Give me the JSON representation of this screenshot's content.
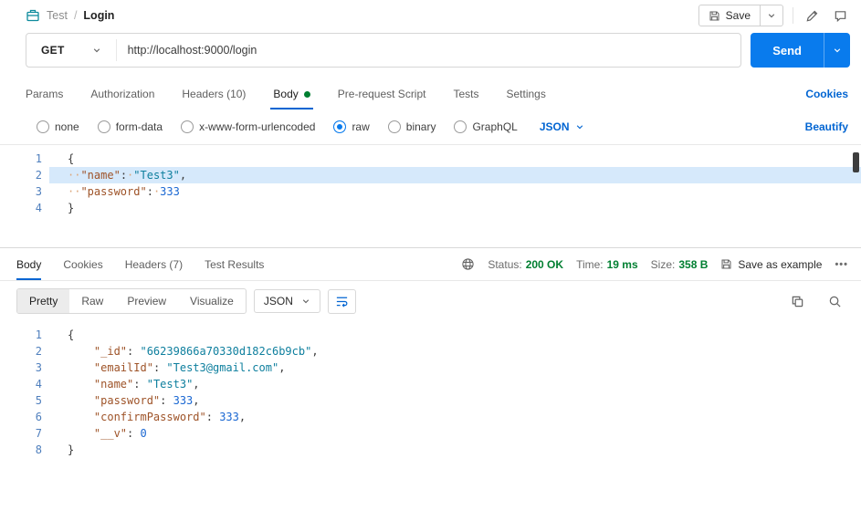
{
  "header": {
    "breadcrumb": {
      "collection": "Test",
      "separator": "/",
      "request": "Login"
    },
    "save_button": "Save"
  },
  "request": {
    "method": "GET",
    "url": "http://localhost:9000/login",
    "send_button": "Send",
    "tabs": [
      {
        "label": "Params",
        "active": false
      },
      {
        "label": "Authorization",
        "active": false
      },
      {
        "label": "Headers (10)",
        "active": false
      },
      {
        "label": "Body",
        "active": true,
        "modified_dot": true
      },
      {
        "label": "Pre-request Script",
        "active": false
      },
      {
        "label": "Tests",
        "active": false
      },
      {
        "label": "Settings",
        "active": false
      }
    ],
    "cookies_link": "Cookies",
    "body_types": [
      {
        "label": "none",
        "selected": false
      },
      {
        "label": "form-data",
        "selected": false
      },
      {
        "label": "x-www-form-urlencoded",
        "selected": false
      },
      {
        "label": "raw",
        "selected": true
      },
      {
        "label": "binary",
        "selected": false
      },
      {
        "label": "GraphQL",
        "selected": false
      }
    ],
    "language": "JSON",
    "beautify_link": "Beautify",
    "editor": {
      "highlight_line": 2,
      "lines": [
        [
          {
            "t": "punct",
            "v": "{"
          }
        ],
        [
          {
            "t": "ws",
            "v": "··"
          },
          {
            "t": "key",
            "v": "\"name\""
          },
          {
            "t": "punct",
            "v": ":"
          },
          {
            "t": "ws",
            "v": "·"
          },
          {
            "t": "str",
            "v": "\"Test3\""
          },
          {
            "t": "punct",
            "v": ","
          }
        ],
        [
          {
            "t": "ws",
            "v": "··"
          },
          {
            "t": "key",
            "v": "\"password\""
          },
          {
            "t": "punct",
            "v": ":"
          },
          {
            "t": "ws",
            "v": "·"
          },
          {
            "t": "num",
            "v": "333"
          }
        ],
        [
          {
            "t": "punct",
            "v": "}"
          }
        ]
      ]
    }
  },
  "response": {
    "tabs": [
      {
        "label": "Body",
        "active": true
      },
      {
        "label": "Cookies",
        "active": false
      },
      {
        "label": "Headers (7)",
        "active": false
      },
      {
        "label": "Test Results",
        "active": false
      }
    ],
    "meta": {
      "status_label": "Status:",
      "status_value": "200 OK",
      "time_label": "Time:",
      "time_value": "19 ms",
      "size_label": "Size:",
      "size_value": "358 B"
    },
    "save_as_example": "Save as example",
    "more_options_glyph": "•••",
    "view_tabs": [
      {
        "label": "Pretty",
        "active": true
      },
      {
        "label": "Raw",
        "active": false
      },
      {
        "label": "Preview",
        "active": false
      },
      {
        "label": "Visualize",
        "active": false
      }
    ],
    "language": "JSON",
    "editor": {
      "lines": [
        [
          {
            "t": "punct",
            "v": "{"
          }
        ],
        [
          {
            "t": "ws",
            "v": "    "
          },
          {
            "t": "key",
            "v": "\"_id\""
          },
          {
            "t": "punct",
            "v": ": "
          },
          {
            "t": "str",
            "v": "\"66239866a70330d182c6b9cb\""
          },
          {
            "t": "punct",
            "v": ","
          }
        ],
        [
          {
            "t": "ws",
            "v": "    "
          },
          {
            "t": "key",
            "v": "\"emailId\""
          },
          {
            "t": "punct",
            "v": ": "
          },
          {
            "t": "str",
            "v": "\"Test3@gmail.com\""
          },
          {
            "t": "punct",
            "v": ","
          }
        ],
        [
          {
            "t": "ws",
            "v": "    "
          },
          {
            "t": "key",
            "v": "\"name\""
          },
          {
            "t": "punct",
            "v": ": "
          },
          {
            "t": "str",
            "v": "\"Test3\""
          },
          {
            "t": "punct",
            "v": ","
          }
        ],
        [
          {
            "t": "ws",
            "v": "    "
          },
          {
            "t": "key",
            "v": "\"password\""
          },
          {
            "t": "punct",
            "v": ": "
          },
          {
            "t": "num",
            "v": "333"
          },
          {
            "t": "punct",
            "v": ","
          }
        ],
        [
          {
            "t": "ws",
            "v": "    "
          },
          {
            "t": "key",
            "v": "\"confirmPassword\""
          },
          {
            "t": "punct",
            "v": ": "
          },
          {
            "t": "num",
            "v": "333"
          },
          {
            "t": "punct",
            "v": ","
          }
        ],
        [
          {
            "t": "ws",
            "v": "    "
          },
          {
            "t": "key",
            "v": "\"__v\""
          },
          {
            "t": "punct",
            "v": ": "
          },
          {
            "t": "num",
            "v": "0"
          }
        ],
        [
          {
            "t": "punct",
            "v": "}"
          }
        ]
      ]
    }
  },
  "colors": {
    "accent_blue": "#0265d2",
    "send_blue": "#097bed",
    "status_green": "#007f31",
    "collection_icon_teal": "#0f8b9d"
  },
  "icons": {
    "collection": "collection-icon",
    "save": "save-icon",
    "chevron": "chevron-down-icon",
    "edit": "pencil-icon",
    "comment": "comment-icon",
    "globe": "globe-icon",
    "more": "more-options-icon",
    "copy": "copy-icon",
    "search": "search-icon",
    "wrap": "wrap-text-icon"
  }
}
